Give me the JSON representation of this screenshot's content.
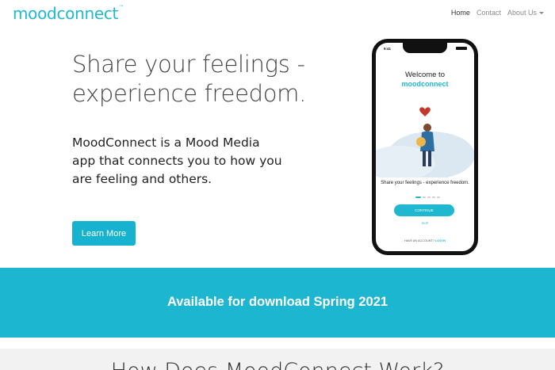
{
  "navbar": {
    "logo_text": "moodconnect",
    "logo_tm": "™",
    "links": [
      {
        "label": "Home"
      },
      {
        "label": "Contact"
      },
      {
        "label": "About Us"
      }
    ]
  },
  "hero": {
    "title": "Share your feelings - experience freedom.",
    "description": "MoodConnect is a Mood Media app that connects you to how you are feeling and others.",
    "button_label": "Learn More"
  },
  "phone": {
    "time": "9:41",
    "welcome": "Welcome to",
    "app_logo": "moodconnect",
    "tagline": "Share your feelings - experience freedom.",
    "continue_label": "CONTINUE",
    "skip_label": "SKIP",
    "account_prefix": "HAVE AN ACCOUNT?",
    "login_label": "LOG IN"
  },
  "banner": {
    "text": "Available for download Spring 2021"
  },
  "how": {
    "title": "How Does MoodConnect Work?"
  },
  "colors": {
    "accent": "#1cb6d1",
    "heart": "#c0392b"
  }
}
